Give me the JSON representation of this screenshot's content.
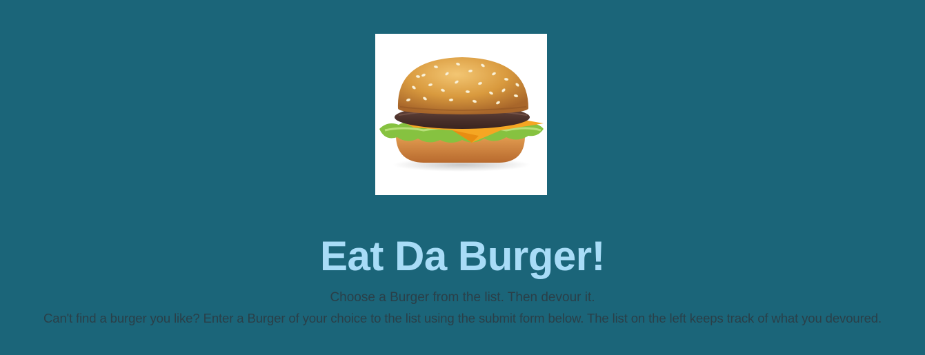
{
  "hero": {
    "image_name": "hamburger-photo"
  },
  "header": {
    "title": "Eat Da Burger!",
    "subtitle_line1": "Choose a Burger from the list. Then devour it.",
    "subtitle_line2": "Can't find a burger you like? Enter a Burger of your choice to the list using the submit form below. The list on the left keeps track of what you devoured."
  },
  "colors": {
    "background": "#1b6579",
    "title": "#a8dcf7",
    "subtitle": "#2a3f48"
  }
}
